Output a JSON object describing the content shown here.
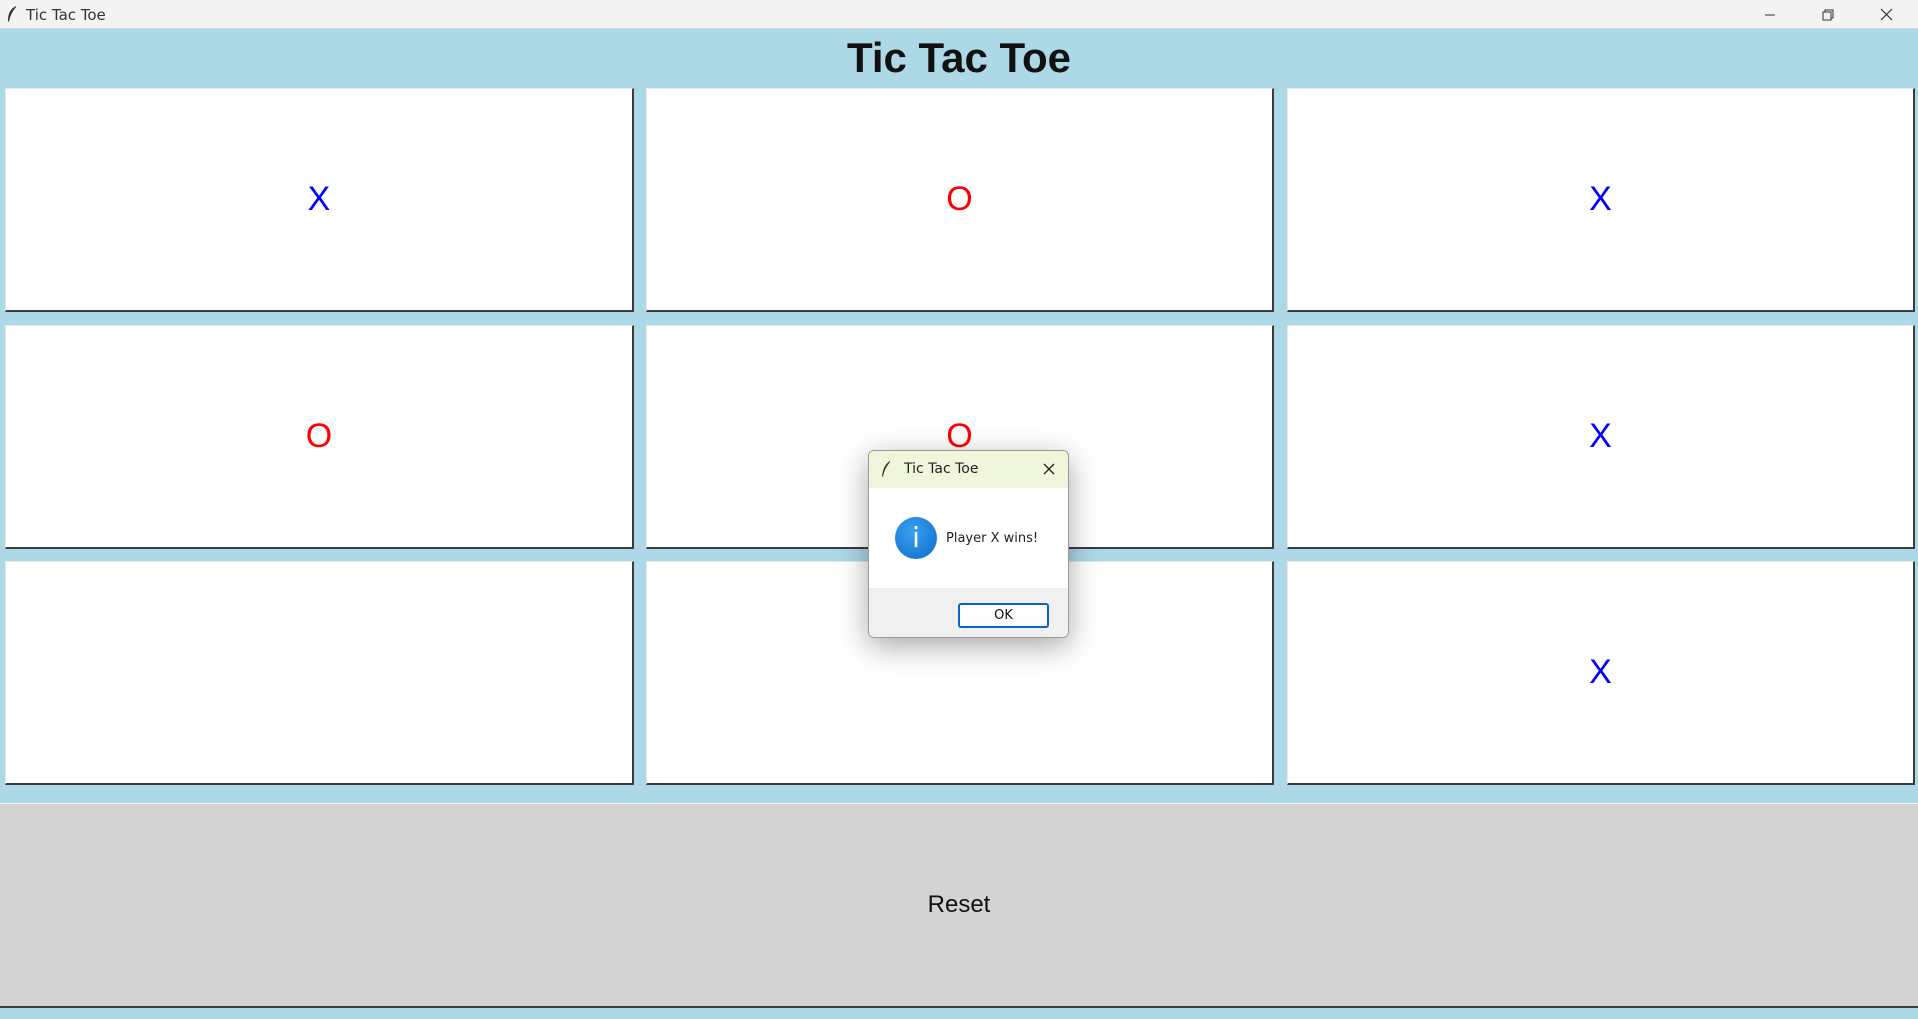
{
  "window": {
    "title": "Tic Tac Toe",
    "icon": "feather-icon",
    "controls": [
      "minimize-icon",
      "restore-icon",
      "close-icon"
    ]
  },
  "header": {
    "title": "Tic Tac Toe"
  },
  "board": {
    "cells": [
      "X",
      "O",
      "X",
      "O",
      "O",
      "X",
      "",
      "",
      "X"
    ],
    "x_color": "#0000ff",
    "o_color": "#ff0000"
  },
  "reset_button": {
    "label": "Reset"
  },
  "dialog": {
    "title": "Tic Tac Toe",
    "icon": "info-icon",
    "icon_glyph": "i",
    "message": "Player X wins!",
    "ok_label": "OK"
  },
  "colors": {
    "background": "#ADD8E6",
    "reset_background": "#D3D3D3"
  }
}
